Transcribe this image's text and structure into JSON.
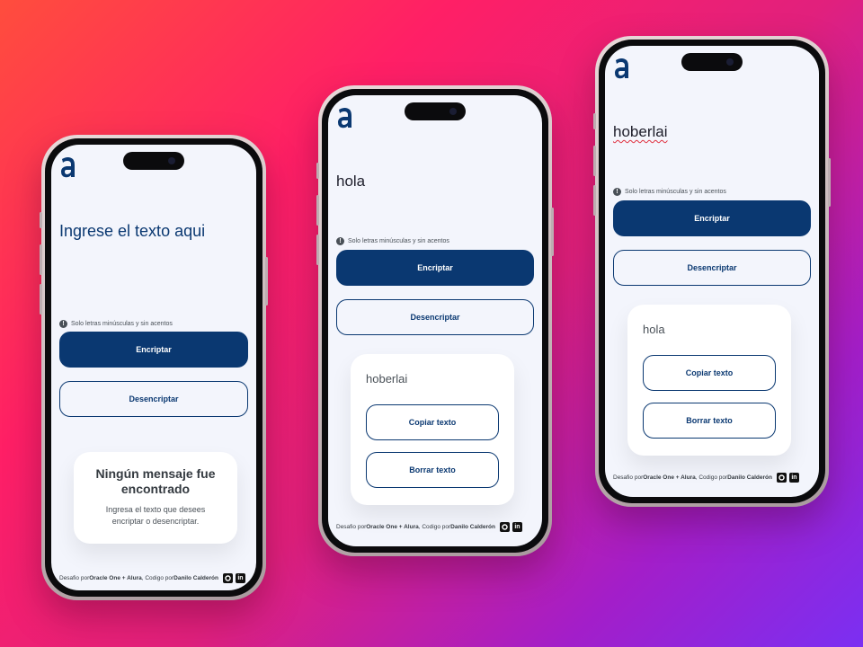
{
  "colors": {
    "primary": "#0a3871",
    "screen_bg": "#f3f5fc"
  },
  "common": {
    "hint": "Solo letras minúsculas y sin acentos",
    "encrypt": "Encriptar",
    "decrypt": "Desencriptar",
    "copy": "Copiar texto",
    "clear": "Borrar texto",
    "footer_prefix": "Desafio por ",
    "footer_org": "Oracle One + Alura",
    "footer_mid": ", Codigo por ",
    "footer_author": "Danilo Calderón",
    "github_icon": "github-icon",
    "linkedin_icon": "linkedin-icon",
    "linkedin_label": "in"
  },
  "phone1": {
    "input_placeholder": "Ingrese el texto aqui",
    "empty_title": "Ningún mensaje fue encontrado",
    "empty_subtitle": "Ingresa el texto que desees encriptar o desencriptar."
  },
  "phone2": {
    "input_value": "hola",
    "output": "hoberlai"
  },
  "phone3": {
    "input_value": "hoberlai",
    "output": "hola"
  }
}
